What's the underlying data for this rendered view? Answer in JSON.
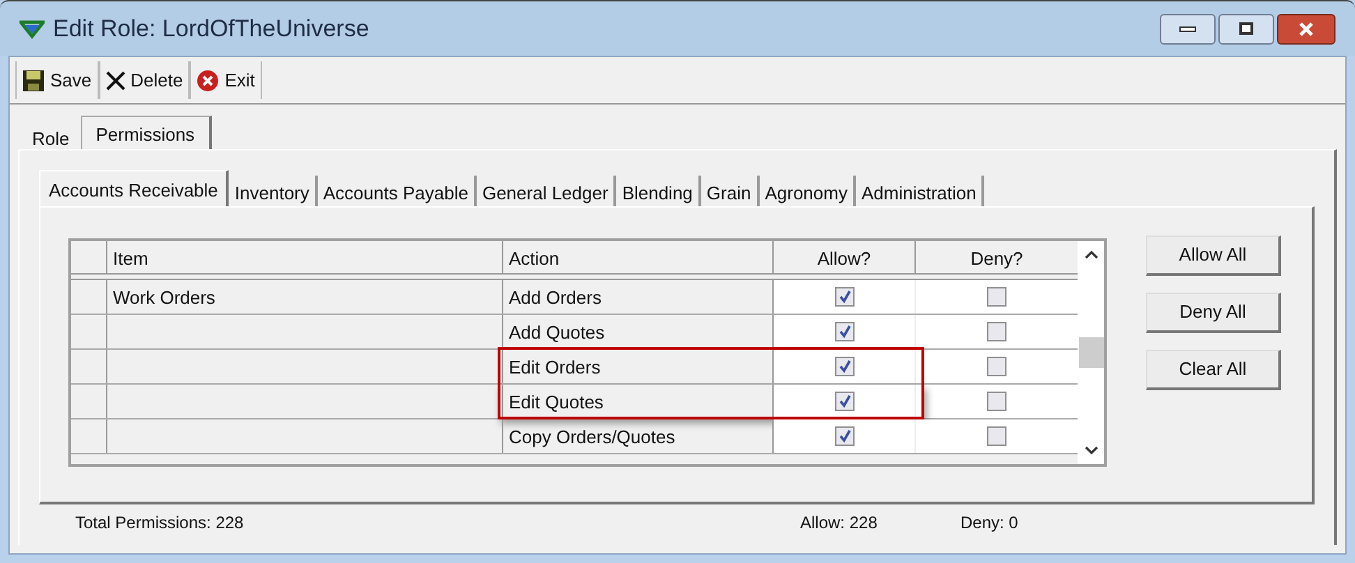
{
  "window": {
    "title": "Edit Role: LordOfTheUniverse"
  },
  "toolbar": [
    {
      "kind": "save",
      "label": "Save"
    },
    {
      "kind": "delete",
      "label": "Delete"
    },
    {
      "kind": "exit",
      "label": "Exit"
    }
  ],
  "tabs": [
    {
      "label": "Role",
      "selected": false
    },
    {
      "label": "Permissions",
      "selected": true
    }
  ],
  "sub_tabs": [
    {
      "label": "Accounts Receivable",
      "selected": true
    },
    {
      "label": "Inventory",
      "selected": false
    },
    {
      "label": "Accounts Payable",
      "selected": false
    },
    {
      "label": "General Ledger",
      "selected": false
    },
    {
      "label": "Blending",
      "selected": false
    },
    {
      "label": "Grain",
      "selected": false
    },
    {
      "label": "Agronomy",
      "selected": false
    },
    {
      "label": "Administration",
      "selected": false
    }
  ],
  "table": {
    "columns": [
      "Item",
      "Action",
      "Allow?",
      "Deny?"
    ],
    "rows": [
      {
        "item": "Work Orders",
        "action": "Add Orders",
        "allow": true,
        "deny": false,
        "highlighted": false
      },
      {
        "action": "Add Quotes",
        "allow": true,
        "deny": false,
        "highlighted": false
      },
      {
        "action": "Edit Orders",
        "allow": true,
        "deny": false,
        "highlighted": true
      },
      {
        "action": "Edit Quotes",
        "allow": true,
        "deny": false,
        "highlighted": true
      },
      {
        "action": "Copy Orders/Quotes",
        "allow": true,
        "deny": false,
        "highlighted": false
      }
    ]
  },
  "buttons": [
    "Allow All",
    "Deny All",
    "Clear All"
  ],
  "status_bar": {
    "total": "Total Permissions: 228",
    "allow": "Allow: 228",
    "deny": "Deny: 0"
  }
}
